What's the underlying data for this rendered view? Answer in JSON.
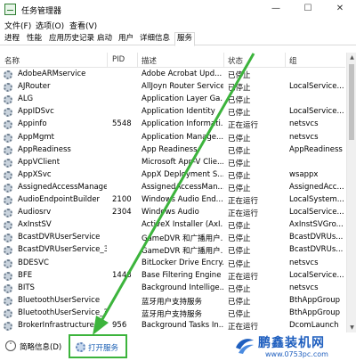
{
  "window": {
    "title": "任务管理器",
    "minimize": "—",
    "maximize": "☐",
    "close": "✕"
  },
  "menu": [
    "文件(F)",
    "选项(O)",
    "查看(V)"
  ],
  "tabs": [
    "进程",
    "性能",
    "应用历史记录",
    "启动",
    "用户",
    "详细信息",
    "服务"
  ],
  "active_tab": "服务",
  "columns": {
    "name": "名称",
    "pid": "PID",
    "desc": "描述",
    "status": "状态",
    "group": "组"
  },
  "services": [
    {
      "name": "AdobeARMservice",
      "pid": "",
      "desc": "Adobe Acrobat Upd...",
      "status": "已停止",
      "group": ""
    },
    {
      "name": "AJRouter",
      "pid": "",
      "desc": "AllJoyn Router Service",
      "status": "已停止",
      "group": "LocalService..."
    },
    {
      "name": "ALG",
      "pid": "",
      "desc": "Application Layer Ga...",
      "status": "已停止",
      "group": ""
    },
    {
      "name": "AppIDSvc",
      "pid": "",
      "desc": "Application Identity",
      "status": "已停止",
      "group": "LocalService..."
    },
    {
      "name": "Appinfo",
      "pid": "5548",
      "desc": "Application Informati...",
      "status": "正在运行",
      "group": "netsvcs"
    },
    {
      "name": "AppMgmt",
      "pid": "",
      "desc": "Application Manage...",
      "status": "已停止",
      "group": "netsvcs"
    },
    {
      "name": "AppReadiness",
      "pid": "",
      "desc": "App Readiness",
      "status": "已停止",
      "group": "AppReadiness"
    },
    {
      "name": "AppVClient",
      "pid": "",
      "desc": "Microsoft App-V Clie...",
      "status": "已停止",
      "group": ""
    },
    {
      "name": "AppXSvc",
      "pid": "",
      "desc": "AppX Deployment S...",
      "status": "已停止",
      "group": "wsappx"
    },
    {
      "name": "AssignedAccessManager...",
      "pid": "",
      "desc": "AssignedAccessMan...",
      "status": "已停止",
      "group": "AssignedAcc..."
    },
    {
      "name": "AudioEndpointBuilder",
      "pid": "2100",
      "desc": "Windows Audio End...",
      "status": "正在运行",
      "group": "LocalSystem..."
    },
    {
      "name": "Audiosrv",
      "pid": "2304",
      "desc": "Windows Audio",
      "status": "正在运行",
      "group": "LocalService..."
    },
    {
      "name": "AxInstSV",
      "pid": "",
      "desc": "ActiveX Installer (AxI...",
      "status": "已停止",
      "group": "AxInstSVGro..."
    },
    {
      "name": "BcastDVRUserService",
      "pid": "",
      "desc": "GameDVR 和广播用户...",
      "status": "已停止",
      "group": "BcastDVRUs..."
    },
    {
      "name": "BcastDVRUserService_3a...",
      "pid": "",
      "desc": "GameDVR 和广播用户...",
      "status": "已停止",
      "group": "BcastDVRUs..."
    },
    {
      "name": "BDESVC",
      "pid": "",
      "desc": "BitLocker Drive Encry...",
      "status": "已停止",
      "group": "netsvcs"
    },
    {
      "name": "BFE",
      "pid": "1448",
      "desc": "Base Filtering Engine",
      "status": "正在运行",
      "group": "LocalService..."
    },
    {
      "name": "BITS",
      "pid": "",
      "desc": "Background Intellige...",
      "status": "已停止",
      "group": "netsvcs"
    },
    {
      "name": "BluetoothUserService",
      "pid": "",
      "desc": "蓝牙用户支持服务",
      "status": "已停止",
      "group": "BthAppGroup"
    },
    {
      "name": "BluetoothUserService_3a...",
      "pid": "",
      "desc": "蓝牙用户支持服务",
      "status": "已停止",
      "group": "BthAppGroup"
    },
    {
      "name": "BrokerInfrastructure",
      "pid": "956",
      "desc": "Background Tasks In...",
      "status": "正在运行",
      "group": "DcomLaunch"
    }
  ],
  "statusbar": {
    "fewer_details": "简略信息(D)",
    "open_services": "打开服务"
  },
  "watermark": {
    "title": "鹏鑫装机网",
    "url": "www.0753pc.com"
  },
  "colors": {
    "annotation": "#3cb43c",
    "link": "#1a5fb4"
  },
  "icons": {
    "app": "task-manager-icon",
    "service": "service-gear-icon",
    "fewer": "chevron-up-icon"
  }
}
